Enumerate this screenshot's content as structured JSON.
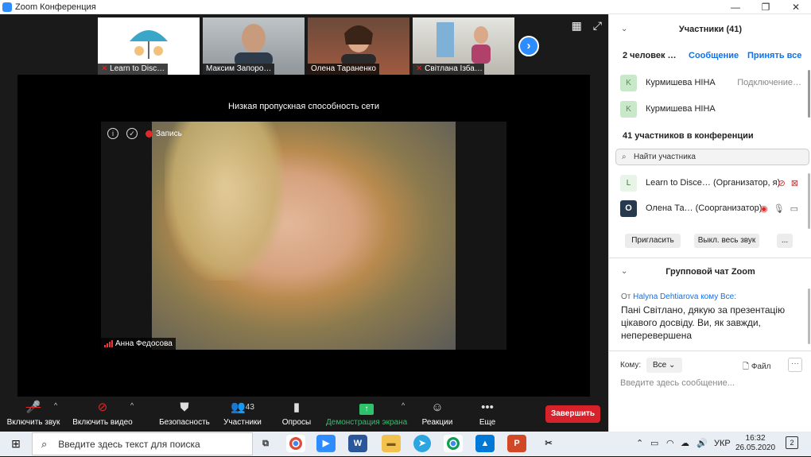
{
  "window": {
    "title": "Zoom Конференция",
    "controls": [
      "—",
      "❐",
      "✕"
    ]
  },
  "video": {
    "thumbnails": [
      {
        "name": "Learn to Disc…",
        "muted": true
      },
      {
        "name": "Максим Запоро…",
        "muted": false
      },
      {
        "name": "Олена Тараненко",
        "muted": false
      },
      {
        "name": "Світлана Ізба…",
        "muted": true
      }
    ],
    "low_bandwidth": "Низкая пропускная способность сети",
    "recording_label": "Запись",
    "speaker_name": "Анна Федосова"
  },
  "toolbar": {
    "mute_label": "Включить звук",
    "video_label": "Включить видео",
    "security_label": "Безопасность",
    "participants_label": "Участники",
    "participants_count": "43",
    "polls_label": "Опросы",
    "share_label": "Демонстрация экрана",
    "reactions_label": "Реакции",
    "more_label": "Еще",
    "end_label": "Завершить"
  },
  "panel": {
    "participants_title": "Участники (41)",
    "waiting_label": "2 человек …",
    "message_link": "Сообщение",
    "admit_all_link": "Принять все",
    "waiting_people": [
      {
        "avatar": "K",
        "name": "Курмишева НІНА",
        "status": "Подключение…"
      },
      {
        "avatar": "K",
        "name": "Курмишева НІНА",
        "status": ""
      }
    ],
    "in_meeting_label": "41 участников в конференции",
    "search_placeholder": "Найти участника",
    "participants": [
      {
        "avatar": "L",
        "name": "Learn to Disce… (Организатор, я)"
      },
      {
        "avatar": "О",
        "name": "Олена Та… (Соорганизатор)"
      }
    ],
    "invite_button": "Пригласить",
    "mute_all_button": "Выкл. весь звук",
    "more_button": "...",
    "chat_title": "Групповой чат Zoom",
    "chat_from_prefix": "От",
    "chat_sender": "Halyna Dehtiarova",
    "chat_to_suffix": "кому Все:",
    "chat_message": "Пані Світлано, дякую за презентацію цікавого досвіду. Ви, як завжди, неперевершена",
    "to_label": "Кому:",
    "to_value": "Все",
    "file_label": "Файл",
    "compose_placeholder": "Введите здесь сообщение..."
  },
  "taskbar": {
    "search_placeholder": "Введите здесь текст для поиска",
    "language": "УКР",
    "time": "16:32",
    "date": "26.05.2020",
    "notifications": "2"
  }
}
